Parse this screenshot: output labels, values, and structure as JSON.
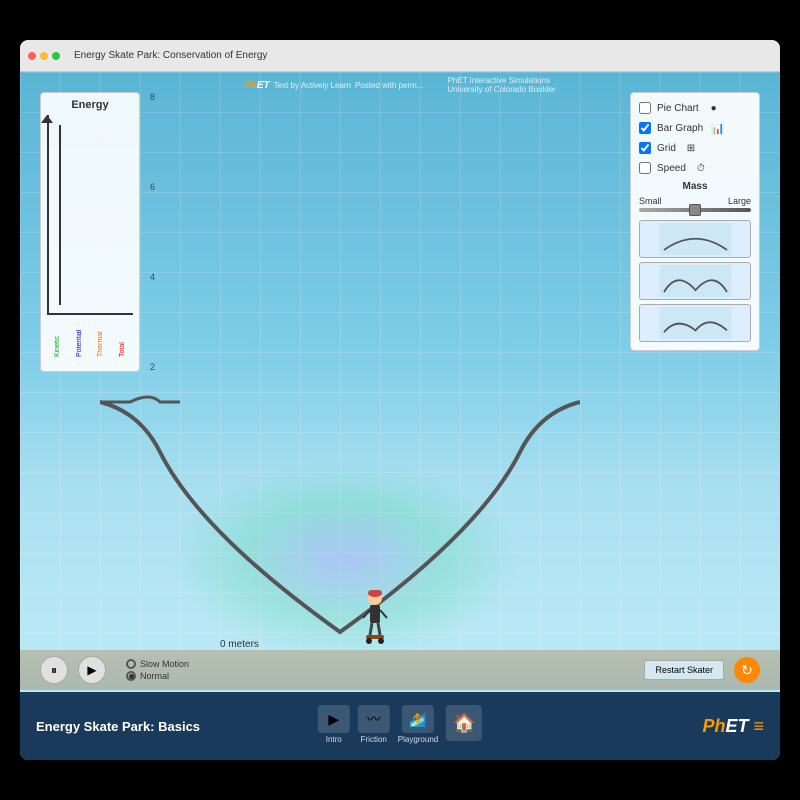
{
  "browser": {
    "title": "Energy Skate Park: Conservation of Energy"
  },
  "phet_header": {
    "logo": "Ph",
    "logo_et": "ET",
    "text": "Text by Actively Learn",
    "posted": "Posted with perm...",
    "subtitle": "PhET Interactive Simulations",
    "university": "University of Colorado Boulder"
  },
  "controls": {
    "pie_chart_label": "Pie Chart",
    "bar_graph_label": "Bar Graph",
    "grid_label": "Grid",
    "speed_label": "Speed",
    "mass_label": "Mass",
    "mass_small": "Small",
    "mass_large": "Large"
  },
  "energy_panel": {
    "title": "Energy",
    "labels": {
      "kinetic": "Kinetic",
      "potential": "Potential",
      "thermal": "Thermal",
      "total": "Total"
    }
  },
  "bottom_controls": {
    "slow_motion_label": "Slow Motion",
    "normal_label": "Normal",
    "restart_label": "Restart Skater"
  },
  "nav": {
    "title": "Energy Skate Park: Basics",
    "tabs": [
      {
        "label": "Intro",
        "icon": "▶"
      },
      {
        "label": "Friction",
        "icon": "〰"
      },
      {
        "label": "Playground",
        "icon": "👤"
      },
      {
        "label": "",
        "icon": "🏠"
      }
    ]
  },
  "y_axis": {
    "values": [
      "8",
      "6",
      "4",
      "2"
    ]
  },
  "meters": {
    "label": "0 meters"
  }
}
